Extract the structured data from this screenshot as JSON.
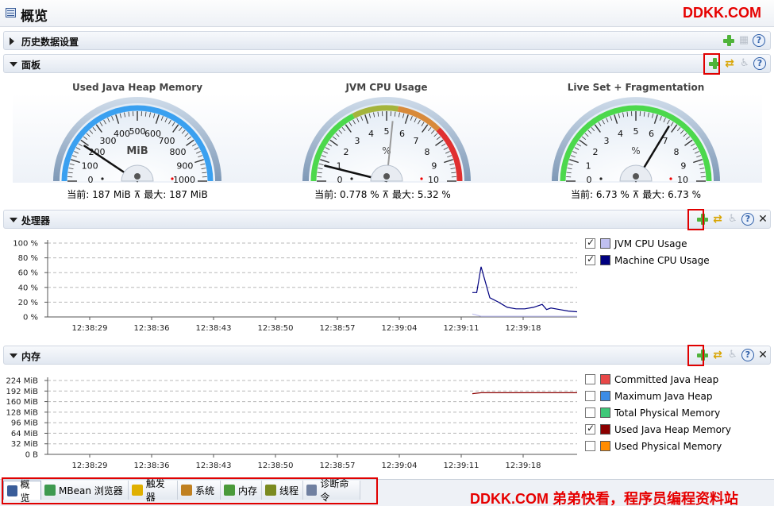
{
  "window": {
    "title": "概览"
  },
  "watermark_top": "DDKK.COM",
  "watermark_bottom": "DDKK.COM 弟弟快看，程序员编程资料站",
  "sections": {
    "history": "历史数据设置",
    "dashboard": "面板",
    "processor": "处理器",
    "memory": "内存"
  },
  "gauges": [
    {
      "title": "Used Java Heap Memory",
      "unit": "MiB",
      "ticks": [
        "0",
        "100",
        "200",
        "300",
        "400",
        "500",
        "600",
        "700",
        "800",
        "900",
        "1000"
      ],
      "max": 1000,
      "value": 187,
      "footer": "当前: 187 MiB ⊼ 最大: 187 MiB"
    },
    {
      "title": "JVM CPU Usage",
      "unit": "%",
      "ticks": [
        "0",
        "1",
        "2",
        "3",
        "4",
        "5",
        "6",
        "7",
        "8",
        "9",
        "10"
      ],
      "max": 10,
      "value": 0.778,
      "footer": "当前: 0.778 % ⊼ 最大: 5.32 %"
    },
    {
      "title": "Live Set + Fragmentation",
      "unit": "%",
      "ticks": [
        "0",
        "1",
        "2",
        "3",
        "4",
        "5",
        "6",
        "7",
        "8",
        "9",
        "10"
      ],
      "max": 10,
      "value": 6.73,
      "footer": "当前: 6.73 % ⊼ 最大: 6.73 %"
    }
  ],
  "chart_data": [
    {
      "type": "line",
      "title": "处理器",
      "x": [
        "12:38:29",
        "12:38:36",
        "12:38:43",
        "12:38:50",
        "12:38:57",
        "12:39:04",
        "12:39:11",
        "12:39:18"
      ],
      "y_ticks": [
        "100 %",
        "80 %",
        "60 %",
        "40 %",
        "20 %",
        "0 %"
      ],
      "ylim": [
        0,
        100
      ],
      "series": [
        {
          "name": "JVM CPU Usage",
          "color": "#c0c0f0",
          "checked": true,
          "points": [
            [
              10,
              4
            ],
            [
              11,
              1
            ],
            [
              12,
              1
            ],
            [
              13,
              1
            ],
            [
              14,
              1
            ],
            [
              15,
              1
            ],
            [
              16,
              1
            ],
            [
              17,
              1
            ],
            [
              18,
              1
            ],
            [
              19,
              1
            ],
            [
              20,
              1
            ],
            [
              21,
              1
            ],
            [
              22,
              1
            ]
          ]
        },
        {
          "name": "Machine CPU Usage",
          "color": "#000080",
          "checked": true,
          "points": [
            [
              10,
              33
            ],
            [
              10.5,
              33
            ],
            [
              11,
              68
            ],
            [
              12,
              26
            ],
            [
              13,
              20
            ],
            [
              14,
              13
            ],
            [
              15,
              11
            ],
            [
              16,
              11
            ],
            [
              17,
              13
            ],
            [
              18,
              17
            ],
            [
              18.5,
              10
            ],
            [
              19,
              12
            ],
            [
              20,
              10
            ],
            [
              21,
              8
            ],
            [
              22,
              7
            ]
          ]
        }
      ]
    },
    {
      "type": "line",
      "title": "内存",
      "x": [
        "12:38:29",
        "12:38:36",
        "12:38:43",
        "12:38:50",
        "12:38:57",
        "12:39:04",
        "12:39:11",
        "12:39:18"
      ],
      "y_ticks": [
        "224 MiB",
        "192 MiB",
        "160 MiB",
        "128 MiB",
        "96 MiB",
        "64 MiB",
        "32 MiB",
        "0 B"
      ],
      "ylim": [
        0,
        224
      ],
      "series": [
        {
          "name": "Committed Java Heap",
          "color": "#e84848",
          "checked": false,
          "points": []
        },
        {
          "name": "Maximum Java Heap",
          "color": "#3c8ce6",
          "checked": false,
          "points": []
        },
        {
          "name": "Total Physical Memory",
          "color": "#3ec878",
          "checked": false,
          "points": []
        },
        {
          "name": "Used Java Heap Memory",
          "color": "#8b0000",
          "checked": true,
          "points": [
            [
              10,
              184
            ],
            [
              11,
              187
            ],
            [
              12,
              187
            ],
            [
              14,
              187
            ],
            [
              16,
              187
            ],
            [
              18,
              187
            ],
            [
              20,
              187
            ],
            [
              22,
              187
            ]
          ]
        },
        {
          "name": "Used Physical Memory",
          "color": "#ff8c00",
          "checked": false,
          "points": []
        }
      ]
    }
  ],
  "tabs": [
    {
      "label": "概览",
      "active": true,
      "icon": "overview-icon",
      "color": "#3a5d99"
    },
    {
      "label": "MBean 浏览器",
      "icon": "mbean-icon",
      "color": "#3e9a50"
    },
    {
      "label": "触发器",
      "icon": "trigger-icon",
      "color": "#e0b000"
    },
    {
      "label": "系统",
      "icon": "system-icon",
      "color": "#c08020"
    },
    {
      "label": "内存",
      "icon": "memory-icon",
      "color": "#4a9a3a"
    },
    {
      "label": "线程",
      "icon": "thread-icon",
      "color": "#7a8a20"
    },
    {
      "label": "诊断命令",
      "icon": "diagnostic-icon",
      "color": "#7080a0"
    }
  ]
}
